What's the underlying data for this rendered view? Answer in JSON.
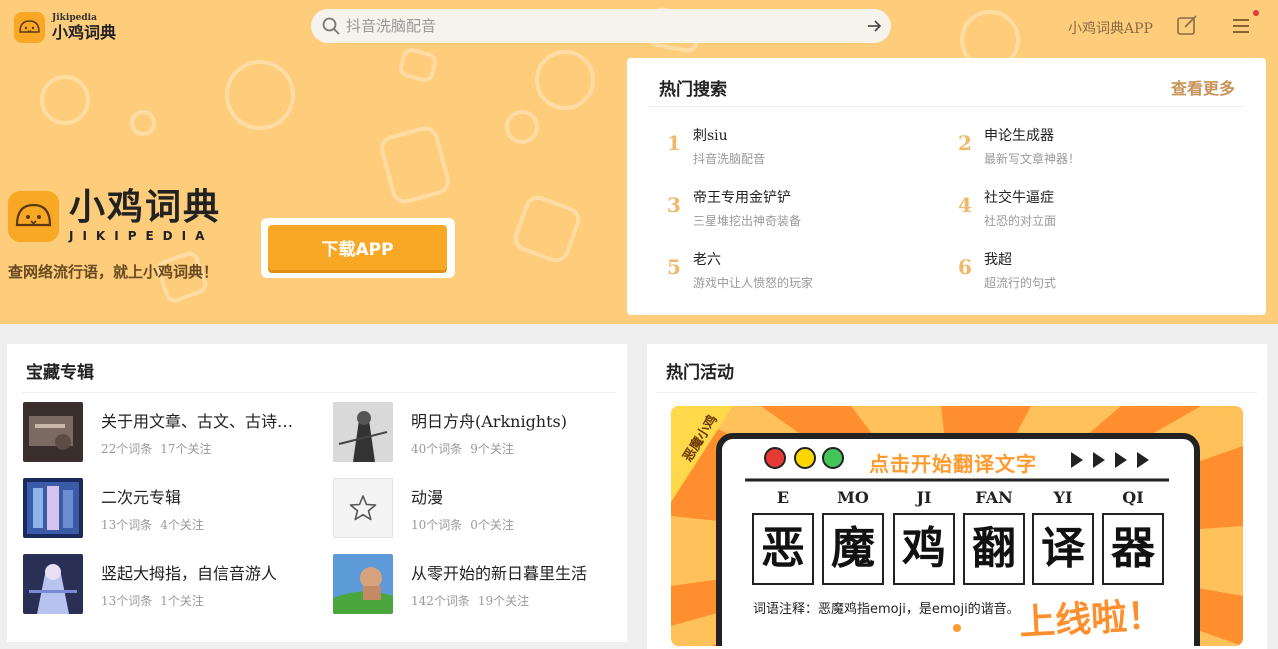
{
  "header": {
    "logo_small": "Jikipedia",
    "logo_big": "小鸡词典",
    "search_placeholder": "抖音洗脑配音",
    "app_link": "小鸡词典APP",
    "icons": [
      "search-icon",
      "arrow-right-icon",
      "edit-icon",
      "menu-icon"
    ]
  },
  "hero": {
    "brand_cn": "小鸡词典",
    "brand_en": "JIKIPEDIA",
    "slogan": "查网络流行语，就上小鸡词典！",
    "download_label": "下载APP"
  },
  "hot_search": {
    "title": "热门搜索",
    "more": "查看更多",
    "items": [
      {
        "rank": "1",
        "word": "刺siu",
        "sub": "抖音洗脑配音"
      },
      {
        "rank": "2",
        "word": "申论生成器",
        "sub": "最新写文章神器！"
      },
      {
        "rank": "3",
        "word": "帝王专用金铲铲",
        "sub": "三星堆挖出神奇装备"
      },
      {
        "rank": "4",
        "word": "社交牛逼症",
        "sub": "社恐的对立面"
      },
      {
        "rank": "5",
        "word": "老六",
        "sub": "游戏中让人愤怒的玩家"
      },
      {
        "rank": "6",
        "word": "我超",
        "sub": "超流行的句式"
      }
    ]
  },
  "albums": {
    "title": "宝藏专辑",
    "items": [
      {
        "name": "关于用文章、古文、古诗…",
        "terms": "22个词条",
        "follows": "17个关注"
      },
      {
        "name": "明日方舟(Arknights)",
        "terms": "40个词条",
        "follows": "9个关注"
      },
      {
        "name": "二次元专辑",
        "terms": "13个词条",
        "follows": "4个关注"
      },
      {
        "name": "动漫",
        "terms": "10个词条",
        "follows": "0个关注"
      },
      {
        "name": "竖起大拇指，自信音游人",
        "terms": "13个词条",
        "follows": "1个关注"
      },
      {
        "name": "从零开始的新日暮里生活",
        "terms": "142个词条",
        "follows": "19个关注"
      }
    ]
  },
  "activities": {
    "title": "热门活动",
    "banner": {
      "corner": "恶魔小鸡",
      "headline": "点击开始翻译文字",
      "pinyin": [
        "E",
        "MO",
        "JI",
        "FAN",
        "YI",
        "QI"
      ],
      "chars": [
        "恶",
        "魔",
        "鸡",
        "翻",
        "译",
        "器"
      ],
      "note": "词语注释：恶魔鸡指emoji，是emoji的谐音。",
      "cta": "上线啦！"
    }
  },
  "colors": {
    "hero_bg": "#fdcd7c",
    "accent": "#f9a825",
    "rank": "#f0b868",
    "more_link": "#c89256"
  }
}
